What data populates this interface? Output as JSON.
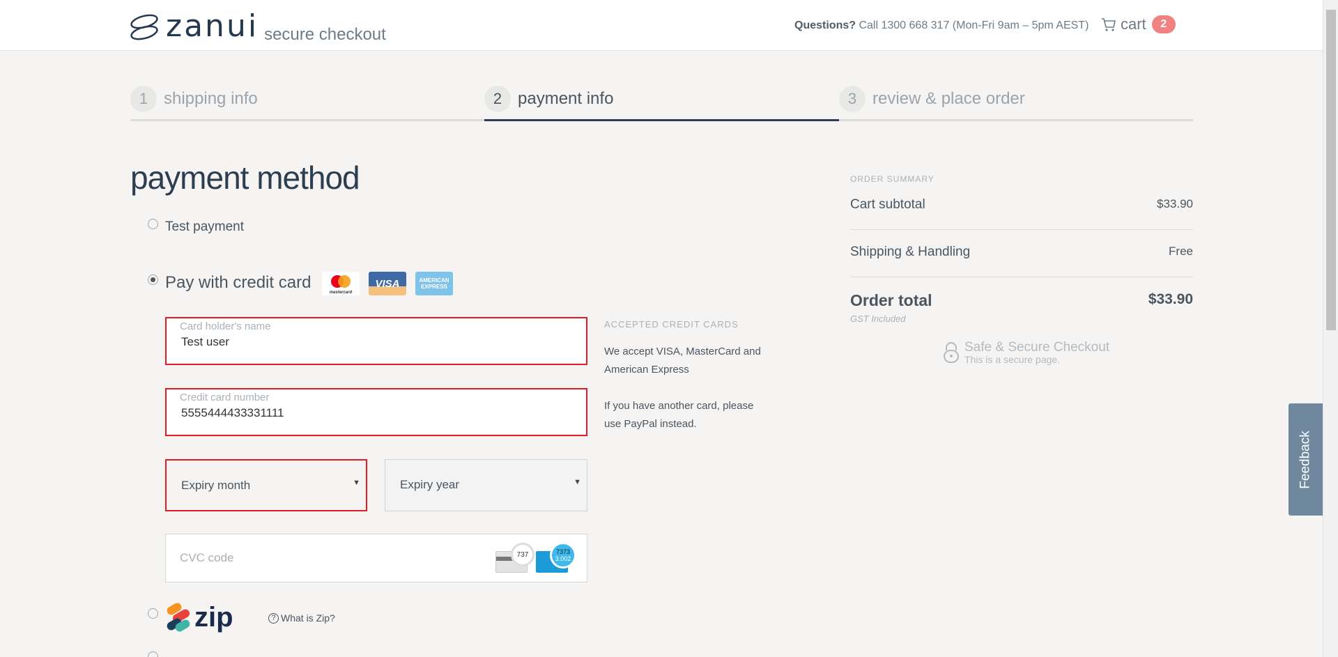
{
  "header": {
    "logo_text": "zanui",
    "logo_sub": "secure checkout",
    "questions_label": "Questions?",
    "questions_text": "Call 1300 668 317 (Mon-Fri 9am – 5pm AEST)",
    "cart_label": "cart",
    "cart_count": "2"
  },
  "steps": [
    {
      "num": "1",
      "label": "shipping info"
    },
    {
      "num": "2",
      "label": "payment info"
    },
    {
      "num": "3",
      "label": "review & place order"
    }
  ],
  "payment": {
    "title": "payment method",
    "test_payment_label": "Test payment",
    "credit_card_label": "Pay with credit card",
    "card_logos": {
      "mastercard": "mastercard",
      "visa": "VISA",
      "amex": "AMERICAN EXPRESS"
    },
    "holder_label": "Card holder's name",
    "holder_value": "Test user",
    "number_label": "Credit card number",
    "number_value": "5555444433331111",
    "expiry_month": "Expiry month",
    "expiry_year": "Expiry year",
    "cvc_placeholder": "CVC code",
    "cvc_badge_1": "737",
    "cvc_badge_2": "7373",
    "cvc_badge_2_sub": "3.002",
    "zip_logo": "zip",
    "zip_help": "What is Zip?"
  },
  "accepted": {
    "heading": "ACCEPTED CREDIT CARDS",
    "line1": "We accept VISA, MasterCard and American Express",
    "line2": "If you have another card, please use PayPal instead."
  },
  "summary": {
    "heading": "ORDER SUMMARY",
    "subtotal_label": "Cart subtotal",
    "subtotal_value": "$33.90",
    "shipping_label": "Shipping & Handling",
    "shipping_value": "Free",
    "total_label": "Order total",
    "total_value": "$33.90",
    "gst": "GST Included",
    "secure_title": "Safe & Secure Checkout",
    "secure_sub": "This is a secure page."
  },
  "feedback_label": "Feedback",
  "colors": {
    "accent": "#2c3e57",
    "error": "#e31b23",
    "badge": "#f08282",
    "feedback": "#6f889e"
  }
}
